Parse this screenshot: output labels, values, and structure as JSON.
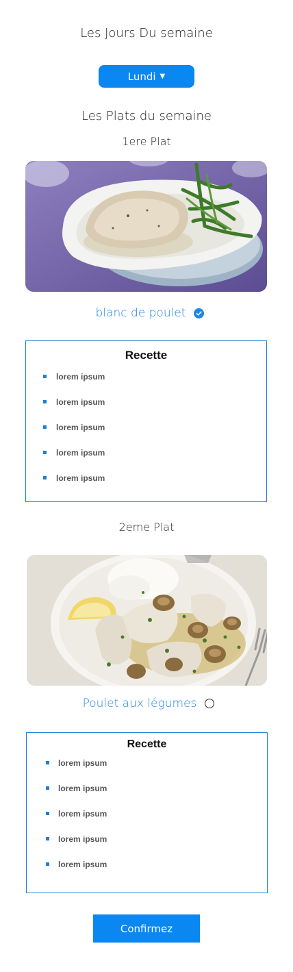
{
  "header": {
    "title": "Les Jours Du semaine"
  },
  "day_select": {
    "selected": "Lundi"
  },
  "dishes_title": "Les Plats du semaine",
  "plats": [
    {
      "heading": "1ere Plat",
      "name": "blanc de poulet",
      "selected": true,
      "recipe_title": "Recette",
      "recipe_items": [
        "lorem ipsum",
        "lorem ipsum",
        "lorem ipsum",
        "lorem ipsum",
        "lorem ipsum"
      ]
    },
    {
      "heading": "2eme Plat",
      "name": "Poulet aux légumes",
      "selected": false,
      "recipe_title": "Recette",
      "recipe_items": [
        "lorem ipsum",
        "lorem ipsum",
        "lorem ipsum",
        "lorem ipsum",
        "lorem ipsum"
      ]
    }
  ],
  "confirm_label": "Confirmez",
  "colors": {
    "accent": "#0a87f0",
    "link": "#1f86e8",
    "border": "#1f7fd4"
  },
  "icons": {
    "dropdown": "caret-down-icon",
    "selected": "check-circle-icon",
    "unselected": "radio-empty-icon"
  }
}
